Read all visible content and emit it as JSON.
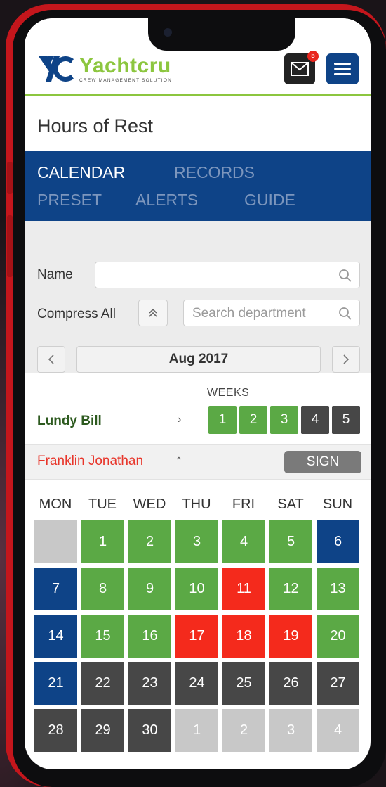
{
  "colors": {
    "green": "#5ba945",
    "dark": "#474747",
    "navy": "#0e4387",
    "red": "#f42a1c",
    "disabled": "#c8c8c8",
    "brand_green": "#8cc63f"
  },
  "header": {
    "logo_name": "Yachtcru",
    "logo_tagline": "CREW MANAGEMENT SOLUTION",
    "mail_badge": "5",
    "mail_icon": "envelope-icon",
    "menu_icon": "hamburger-icon"
  },
  "page": {
    "title": "Hours of Rest"
  },
  "tabs": [
    {
      "label": "CALENDAR",
      "active": true
    },
    {
      "label": "RECORDS",
      "active": false
    },
    {
      "label": "PRESET",
      "active": false
    },
    {
      "label": "ALERTS",
      "active": false
    },
    {
      "label": "GUIDE",
      "active": false
    }
  ],
  "filters": {
    "name_label": "Name",
    "name_value": "",
    "compress_label": "Compress All",
    "department_placeholder": "Search department",
    "month": "Aug 2017"
  },
  "weeks_label": "WEEKS",
  "crew": [
    {
      "name": "Lundy Bill",
      "weeks": [
        {
          "label": "1",
          "status": "green"
        },
        {
          "label": "2",
          "status": "green"
        },
        {
          "label": "3",
          "status": "green"
        },
        {
          "label": "4",
          "status": "dark"
        },
        {
          "label": "5",
          "status": "dark"
        }
      ]
    },
    {
      "name": "Franklin Jonathan",
      "sign_label": "SIGN"
    }
  ],
  "days_of_week": [
    "MON",
    "TUE",
    "WED",
    "THU",
    "FRI",
    "SAT",
    "SUN"
  ],
  "calendar": [
    {
      "label": "",
      "status": "disabled"
    },
    {
      "label": "1",
      "status": "green"
    },
    {
      "label": "2",
      "status": "green"
    },
    {
      "label": "3",
      "status": "green"
    },
    {
      "label": "4",
      "status": "green"
    },
    {
      "label": "5",
      "status": "green"
    },
    {
      "label": "6",
      "status": "navy"
    },
    {
      "label": "7",
      "status": "navy"
    },
    {
      "label": "8",
      "status": "green"
    },
    {
      "label": "9",
      "status": "green"
    },
    {
      "label": "10",
      "status": "green"
    },
    {
      "label": "11",
      "status": "red"
    },
    {
      "label": "12",
      "status": "green"
    },
    {
      "label": "13",
      "status": "green"
    },
    {
      "label": "14",
      "status": "navy"
    },
    {
      "label": "15",
      "status": "green"
    },
    {
      "label": "16",
      "status": "green"
    },
    {
      "label": "17",
      "status": "red"
    },
    {
      "label": "18",
      "status": "red"
    },
    {
      "label": "19",
      "status": "red"
    },
    {
      "label": "20",
      "status": "green"
    },
    {
      "label": "21",
      "status": "navy"
    },
    {
      "label": "22",
      "status": "dark"
    },
    {
      "label": "23",
      "status": "dark"
    },
    {
      "label": "24",
      "status": "dark"
    },
    {
      "label": "25",
      "status": "dark"
    },
    {
      "label": "26",
      "status": "dark"
    },
    {
      "label": "27",
      "status": "dark"
    },
    {
      "label": "28",
      "status": "dark"
    },
    {
      "label": "29",
      "status": "dark"
    },
    {
      "label": "30",
      "status": "dark"
    },
    {
      "label": "1",
      "status": "disabled"
    },
    {
      "label": "2",
      "status": "disabled"
    },
    {
      "label": "3",
      "status": "disabled"
    },
    {
      "label": "4",
      "status": "disabled"
    }
  ]
}
